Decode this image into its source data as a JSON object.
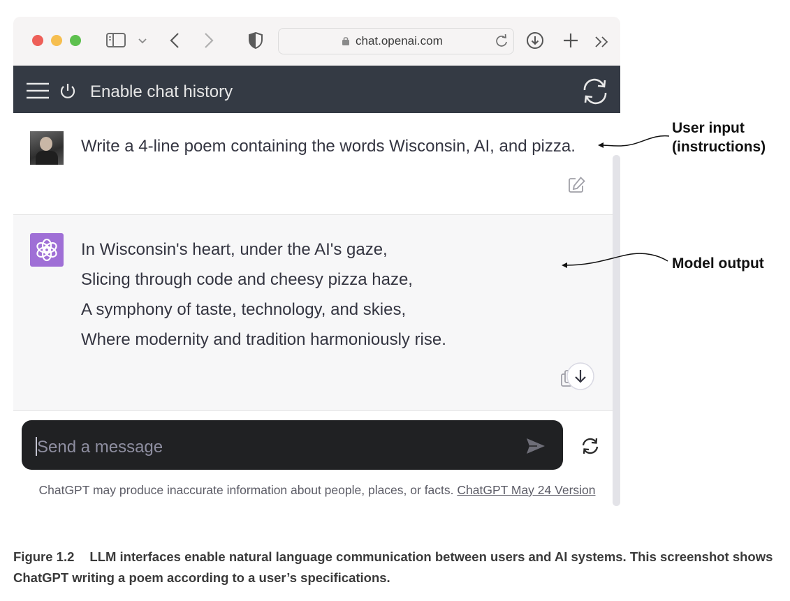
{
  "browser": {
    "url": "chat.openai.com"
  },
  "header": {
    "title": "Enable chat history"
  },
  "conversation": {
    "user_message": "Write a 4-line poem containing the words Wisconsin, AI, and pizza.",
    "model_lines": [
      "In Wisconsin's heart, under the AI's gaze,",
      "Slicing through code and cheesy pizza haze,",
      "A symphony of taste, technology, and skies,",
      "Where modernity and tradition harmoniously rise."
    ]
  },
  "composer": {
    "placeholder": "Send a message"
  },
  "footer": {
    "disclaimer": "ChatGPT may produce inaccurate information about people, places, or facts.",
    "version_link": "ChatGPT May 24 Version"
  },
  "annotations": {
    "user_input_line1": "User input",
    "user_input_line2": "(instructions)",
    "model_output": "Model output"
  },
  "caption": {
    "figure_number": "Figure 1.2",
    "text": "LLM interfaces enable natural language communication between users and AI systems. This screenshot shows ChatGPT writing a poem according to a user’s specifications."
  },
  "icons": [
    "sidebar-toggle-icon",
    "chevron-down-icon",
    "back-icon",
    "forward-icon",
    "shield-icon",
    "lock-icon",
    "reload-icon",
    "download-icon",
    "new-tab-icon",
    "more-tabs-icon",
    "menu-icon",
    "power-icon",
    "refresh-icon",
    "edit-icon",
    "copy-icon",
    "scroll-down-icon",
    "send-icon",
    "regenerate-icon"
  ],
  "colors": {
    "header_bg": "#343a44",
    "composer_bg": "#202123",
    "model_row_bg": "#f7f7f8",
    "gpt_logo_bg": "#9f6fd6"
  }
}
